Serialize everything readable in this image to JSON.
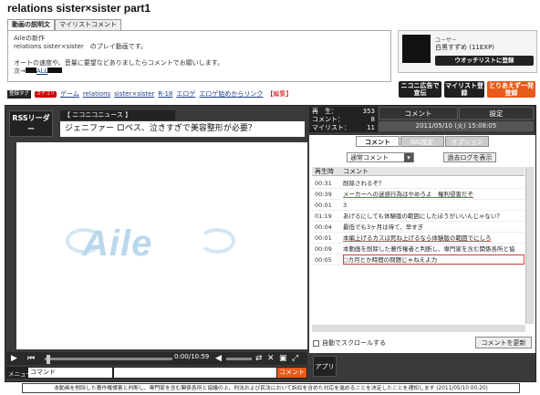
{
  "page": {
    "title": "relations sister×sister part1"
  },
  "tabs": {
    "description": "動画の説明文",
    "mylist_comment": "マイリストコメント"
  },
  "description": {
    "lines": [
      "Aileの新作",
      "relations sister×sister　のプレイ動画です。",
      "",
      "オートの速度や、音量に要望などありましたらコメントでお願いします。",
      "次→"
    ],
    "next_link": "ALL"
  },
  "uploader": {
    "label": "ユーザー",
    "name": "白黒すずめ (11EXP)",
    "watch_button": "ウオッチリストに登録"
  },
  "tags": {
    "label": "登録タグ",
    "lock_badge": "カテゴリ",
    "items": [
      "ゲーム",
      "relations",
      "sister×sister",
      "R-18",
      "エロゲ",
      "エロゲ始めからリンク"
    ],
    "edit": "【編集】"
  },
  "ad_buttons": {
    "senden": "ニコニ広告で宣伝",
    "mylist": "マイリスト登録",
    "toriaezu": "とりあえず一発登録"
  },
  "player": {
    "rss_label": "RSSリーダー",
    "news_label": "【 ニコニコニュース 】",
    "news_title": "ジェニファー ロペス、泣きすぎで美容整形が必要？",
    "logo_text": "Aile",
    "time": "0:00/10:59",
    "menu_label": "メニュー",
    "command_placeholder": "コマンド",
    "comment_button": "コメント"
  },
  "stats": {
    "views_label": "再　生：",
    "views": "353",
    "comments_label": "コメント：",
    "comments": "8",
    "mylist_label": "マイリスト：",
    "mylist": "11"
  },
  "side_header": {
    "comment": "コメント",
    "settings": "設定",
    "datetime": "2011/05/10 (火) 15:08:05"
  },
  "side_tabs": {
    "comment": "コメント",
    "ng": "NG設定",
    "options": "オプション"
  },
  "comment_panel": {
    "filter": "通常コメント",
    "past_log_button": "過去ログを表示",
    "col_time": "再生時",
    "col_comment": "コメント",
    "rows": [
      {
        "time": "00:31",
        "text": "削除されるぞ？"
      },
      {
        "time": "00:39",
        "text": "メーカーへの迷惑行為はやめろよ　権利侵害だぞ"
      },
      {
        "time": "00:01",
        "text": "3"
      },
      {
        "time": "01:19",
        "text": "あげるにしても体験版の範囲にしたほうがいいんじゃない？"
      },
      {
        "time": "00:04",
        "text": "最低でも3ヶ月は待て、早すぎ"
      },
      {
        "time": "00:01",
        "text": "本編上げるカスは死ね上げるなら体験版の範囲でにしろ"
      },
      {
        "time": "00:09",
        "text": "本動画を削除した著作権者と判断し、専門家を含む関係各所と協"
      },
      {
        "time": "00:05",
        "text": "○カ月とか時間の問題じゃねえよ力"
      }
    ],
    "auto_scroll_label": "自動でスクロールする",
    "refresh_button": "コメントを更新",
    "app_button": "アプリ"
  },
  "footer": {
    "notice": "本動画を削除した著作権侵害と判断し、専門家を含む関係各所と協議の上、刑法および民法において訴訟を含めた対応を進めることを決定したことを通知します (2011/05/10 00:20)"
  },
  "colors": {
    "accent": "#e85a19",
    "tag_link": "#1a3e8c",
    "edit": "#c00000"
  }
}
